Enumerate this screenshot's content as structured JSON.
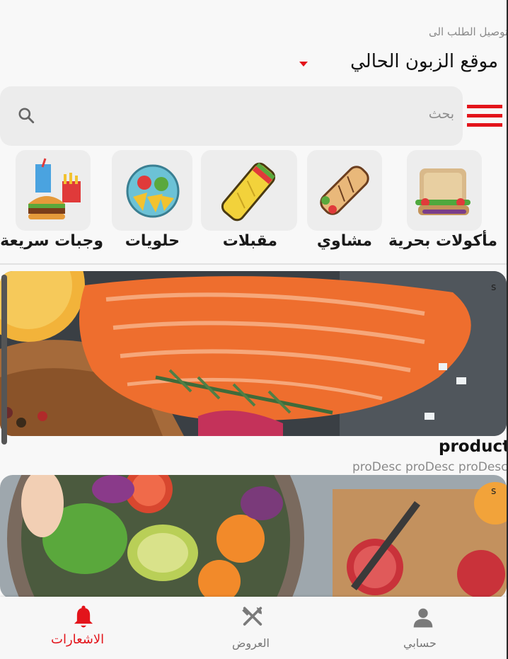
{
  "header": {
    "delivery_caption": "توصيل الطلب الى",
    "location": "موقع الزبون الحالي"
  },
  "search": {
    "placeholder": "بحث"
  },
  "categories": [
    {
      "label": "مأكولات بحرية"
    },
    {
      "label": "مشاوي"
    },
    {
      "label": "مقبلات"
    },
    {
      "label": "حلويات"
    },
    {
      "label": "وجبات سريعة"
    }
  ],
  "products": [
    {
      "badge": "s",
      "name": "product n",
      "desc": "proDesc proDesc proDesc"
    },
    {
      "badge": "s"
    }
  ],
  "bottom_nav": {
    "items": [
      {
        "label": "حسابي",
        "icon": "person-icon"
      },
      {
        "label": "العروض",
        "icon": "fork-knife-icon"
      },
      {
        "label": "الاشعارات",
        "icon": "bell-icon",
        "active": true
      }
    ]
  },
  "colors": {
    "accent": "#e3141b",
    "background": "#f8f8f8",
    "tile": "#ededed"
  }
}
